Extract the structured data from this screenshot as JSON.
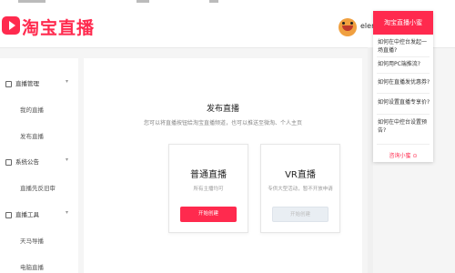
{
  "header": {
    "logo_text": "淘宝直播",
    "username": "elerachi"
  },
  "sidebar": {
    "groups": [
      {
        "label": "直播管理",
        "items": [
          "我的直播",
          "发布直播"
        ]
      },
      {
        "label": "系统公告",
        "items": [
          "直播先反旧审"
        ]
      },
      {
        "label": "直播工具",
        "items": [
          "天马导播",
          "电脑直播"
        ]
      }
    ]
  },
  "main": {
    "title": "发布直播",
    "description": "您可以将直播按钮给淘宝直播频道，也可以推送至微淘、个人主页",
    "cards": [
      {
        "title": "普通直播",
        "subtitle": "所有主播均可",
        "button": "开始创建"
      },
      {
        "title": "VR直播",
        "subtitle": "专供大型活动，暂不开放申请",
        "button": "开始创建"
      }
    ]
  },
  "help": {
    "title": "淘宝直播小蜜",
    "questions": [
      "如何在中控台发起一场直播?",
      "如何用PC端推流?",
      "如何在直播发优惠券?",
      "如何设置直播专享价?",
      "如何在中控台设置预告?"
    ],
    "footer": "咨询小蜜 ⊙"
  },
  "colors": {
    "brand": "#ff2a4e",
    "disabled_button": "#e9eef3"
  }
}
